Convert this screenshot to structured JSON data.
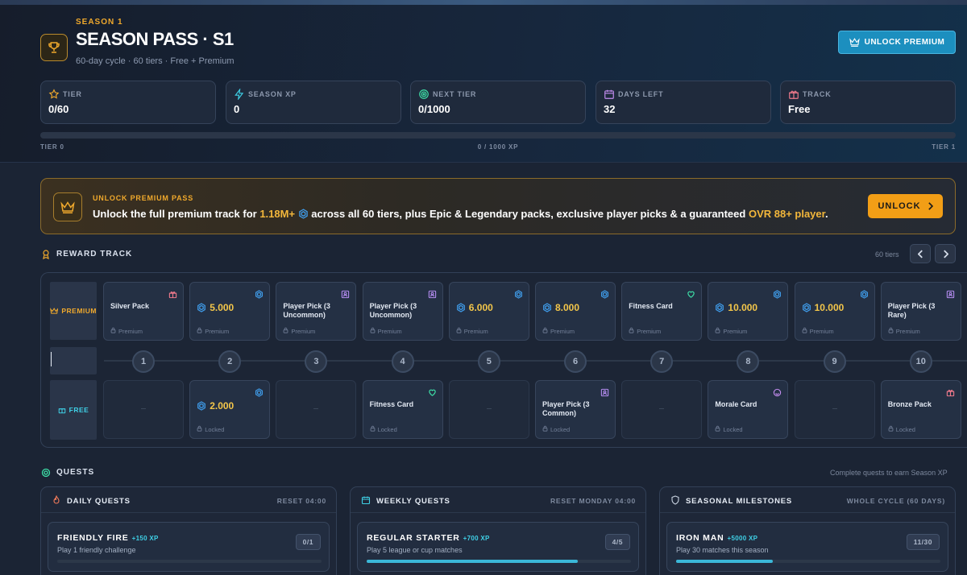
{
  "header": {
    "season_label": "SEASON 1",
    "title": "SEASON PASS · S1",
    "subtitle": "60-day cycle · 60 tiers · Free + Premium",
    "unlock_premium_label": "UNLOCK PREMIUM"
  },
  "stats": [
    {
      "label": "TIER",
      "value": "0/60",
      "icon": "star-icon"
    },
    {
      "label": "SEASON XP",
      "value": "0",
      "icon": "bolt-icon"
    },
    {
      "label": "NEXT TIER",
      "value": "0/1000",
      "icon": "target-icon"
    },
    {
      "label": "DAYS LEFT",
      "value": "32",
      "icon": "calendar-icon"
    },
    {
      "label": "TRACK",
      "value": "Free",
      "icon": "gift-icon"
    }
  ],
  "progress": {
    "left_label": "TIER 0",
    "center_label": "0 / 1000 XP",
    "right_label": "TIER 1",
    "fraction": 0.0
  },
  "banner": {
    "label": "UNLOCK PREMIUM PASS",
    "text_before": "Unlock the full premium track for ",
    "highlight_amount": "1.18M+",
    "text_middle": " across all 60 tiers, plus Epic & Legendary packs, exclusive player picks & a guaranteed ",
    "highlight_player": "OVR 88+ player",
    "text_end": ".",
    "button_label": "UNLOCK"
  },
  "reward_track": {
    "title": "REWARD TRACK",
    "tiers_count": "60 tiers",
    "premium_label": "PREMIUM",
    "free_label": "FREE",
    "premium_footer": "Premium",
    "locked_footer": "Locked",
    "tiers": [
      "1",
      "2",
      "3",
      "4",
      "5",
      "6",
      "7",
      "8",
      "9",
      "10"
    ],
    "premium": [
      {
        "name": "Silver Pack",
        "kind": "gift"
      },
      {
        "amount": "5.000",
        "kind": "coin"
      },
      {
        "name": "Player Pick (3 Uncommon)",
        "kind": "player"
      },
      {
        "name": "Player Pick (3 Uncommon)",
        "kind": "player"
      },
      {
        "amount": "6.000",
        "kind": "coin"
      },
      {
        "amount": "8.000",
        "kind": "coin"
      },
      {
        "name": "Fitness Card",
        "kind": "heart"
      },
      {
        "amount": "10.000",
        "kind": "coin"
      },
      {
        "amount": "10.000",
        "kind": "coin"
      },
      {
        "name": "Player Pick (3 Rare)",
        "kind": "player"
      }
    ],
    "free": [
      null,
      {
        "amount": "2.000",
        "kind": "coin"
      },
      null,
      {
        "name": "Fitness Card",
        "kind": "heart"
      },
      null,
      {
        "name": "Player Pick (3 Common)",
        "kind": "player"
      },
      null,
      {
        "name": "Morale Card",
        "kind": "smile"
      },
      null,
      {
        "name": "Bronze Pack",
        "kind": "gift"
      }
    ]
  },
  "quests": {
    "title": "QUESTS",
    "note": "Complete quests to earn Season XP",
    "panels": [
      {
        "title": "DAILY QUESTS",
        "reset": "RESET 04:00",
        "icon": "flame-icon",
        "quest": {
          "name": "FRIENDLY FIRE",
          "xp": "+150 XP",
          "desc": "Play 1 friendly challenge",
          "count": "0/1",
          "progress": 0.0
        }
      },
      {
        "title": "WEEKLY QUESTS",
        "reset": "RESET MONDAY 04:00",
        "icon": "calendar-icon",
        "quest": {
          "name": "REGULAR STARTER",
          "xp": "+700 XP",
          "desc": "Play 5 league or cup matches",
          "count": "4/5",
          "progress": 0.8
        }
      },
      {
        "title": "SEASONAL MILESTONES",
        "reset": "WHOLE CYCLE (60 DAYS)",
        "icon": "shield-icon",
        "quest": {
          "name": "IRON MAN",
          "xp": "+5000 XP",
          "desc": "Play 30 matches this season",
          "count": "11/30",
          "progress": 0.3667
        }
      }
    ]
  },
  "colors": {
    "accent": "#1c8fbf",
    "gold": "#f0a92c",
    "cyan": "#3fd0e6",
    "background": "#1b2434"
  }
}
